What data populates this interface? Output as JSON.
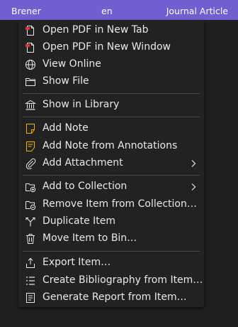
{
  "table_row": {
    "author": "Brener",
    "language": "en",
    "item_type": "Journal Article"
  },
  "colors": {
    "row_highlight": "#6f5fd1",
    "menu_background": "#222222",
    "text": "#e9e9e9",
    "pdf_icon_red": "#d9363e",
    "note_icon_yellow": "#f0b400"
  },
  "menu": {
    "open_pdf_new_tab": "Open PDF in New Tab",
    "open_pdf_new_window": "Open PDF in New Window",
    "view_online": "View Online",
    "show_file": "Show File",
    "show_in_library": "Show in Library",
    "add_note": "Add Note",
    "add_note_from_annotations": "Add Note from Annotations",
    "add_attachment": "Add Attachment",
    "add_to_collection": "Add to Collection",
    "remove_from_collection": "Remove Item from Collection…",
    "duplicate_item": "Duplicate Item",
    "move_to_bin": "Move Item to Bin…",
    "export_item": "Export Item…",
    "create_bibliography": "Create Bibliography from Item…",
    "generate_report": "Generate Report from Item…"
  },
  "icons": {
    "open_pdf_new_tab": "pdf-icon",
    "open_pdf_new_window": "pdf-icon",
    "view_online": "globe-icon",
    "show_file": "folder-icon",
    "show_in_library": "library-icon",
    "add_note": "note-icon",
    "add_note_from_annotations": "note-annotations-icon",
    "add_attachment": "paperclip-icon",
    "add_to_collection": "collection-add-icon",
    "remove_from_collection": "collection-remove-icon",
    "duplicate_item": "duplicate-icon",
    "move_to_bin": "trash-icon",
    "export_item": "export-icon",
    "create_bibliography": "bibliography-icon",
    "generate_report": "report-icon",
    "submenu_arrow": "chevron-right-icon"
  }
}
